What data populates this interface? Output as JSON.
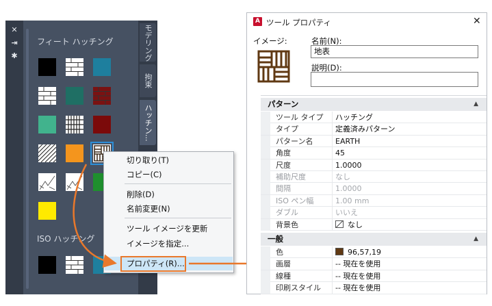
{
  "palette": {
    "strip_buttons": [
      "✕",
      "⇥",
      "✱"
    ],
    "section1_label": "フィート ハッチング",
    "section2_label": "ISO ハッチング",
    "tabs": [
      "モデリング",
      "拘束",
      "ハッチン..."
    ],
    "active_tab_index": 2,
    "swatches": [
      {
        "name": "swatch-solid-black",
        "color": "#000000",
        "pattern": "solid"
      },
      {
        "name": "swatch-brick",
        "color": "#ffffff",
        "pattern": "brick"
      },
      {
        "name": "swatch-solid-teal",
        "color": "#1e7f9e",
        "pattern": "solid"
      },
      {
        "name": "swatch-brick-white",
        "color": "#ffffff",
        "pattern": "brick"
      },
      {
        "name": "swatch-solid-darkteal",
        "color": "#1f6f64",
        "pattern": "solid"
      },
      {
        "name": "swatch-brick-red",
        "color": "#7a1212",
        "pattern": "brick"
      },
      {
        "name": "swatch-solid-seagreen",
        "color": "#41b38d",
        "pattern": "solid"
      },
      {
        "name": "swatch-grid",
        "color": "#ffffff",
        "pattern": "grid"
      },
      {
        "name": "swatch-solid-maroon",
        "color": "#7b0a0a",
        "pattern": "solid"
      },
      {
        "name": "swatch-diagonal",
        "color": "#ffffff",
        "pattern": "diagonal"
      },
      {
        "name": "swatch-solid-orange",
        "color": "#f4951d",
        "pattern": "solid"
      },
      {
        "name": "swatch-earth",
        "color": "#ffffff",
        "pattern": "earth"
      },
      {
        "name": "swatch-sketch1",
        "color": "#ffffff",
        "pattern": "sketch"
      },
      {
        "name": "swatch-sketch2",
        "color": "#ffffff",
        "pattern": "sketch"
      },
      {
        "name": "swatch-solid-green",
        "color": "#1f8f2e",
        "pattern": "solid"
      },
      {
        "name": "swatch-solid-yellow",
        "color": "#ffea00",
        "pattern": "solid"
      },
      {
        "name": "swatch-iso-black",
        "color": "#000000",
        "pattern": "solid"
      },
      {
        "name": "swatch-iso-brick",
        "color": "#ffffff",
        "pattern": "brick"
      },
      {
        "name": "swatch-iso-teal",
        "color": "#1e7f9e",
        "pattern": "solid"
      }
    ]
  },
  "context_menu": {
    "items": [
      "切り取り(T)",
      "コピー(C)",
      "削除(D)",
      "名前変更(N)",
      "ツール イメージを更新",
      "イメージを指定...",
      "プロパティ(R)..."
    ],
    "highlighted_index": 6
  },
  "dialog": {
    "title": "ツール プロパティ",
    "close": "✕",
    "app_icon": "A",
    "image_label": "イメージ:",
    "name_label": "名前(N):",
    "name_value": "地表",
    "desc_label": "説明(D):",
    "desc_value": "",
    "categories": [
      {
        "label": "パターン",
        "toggle": "▲",
        "rows": [
          {
            "name": "ツール タイプ",
            "value": "ハッチング",
            "dim": false
          },
          {
            "name": "タイプ",
            "value": "定義済みパターン",
            "dim": false
          },
          {
            "name": "パターン名",
            "value": "EARTH",
            "dim": false
          },
          {
            "name": "角度",
            "value": "45",
            "dim": false
          },
          {
            "name": "尺度",
            "value": "1.0000",
            "dim": false
          },
          {
            "name": "補助尺度",
            "value": "なし",
            "dim": true
          },
          {
            "name": "間隔",
            "value": "1.0000",
            "dim": true
          },
          {
            "name": "ISO ペン幅",
            "value": "1.00 mm",
            "dim": true
          },
          {
            "name": "ダブル",
            "value": "いいえ",
            "dim": true
          },
          {
            "name": "背景色",
            "value": "なし",
            "dim": false
          }
        ]
      },
      {
        "label": "一般",
        "toggle": "▲",
        "rows": [
          {
            "name": "色",
            "value": "96,57,19",
            "dim": false
          },
          {
            "name": "画層",
            "value": "-- 現在を使用",
            "dim": false
          },
          {
            "name": "線種",
            "value": "-- 現在を使用",
            "dim": false
          },
          {
            "name": "印刷スタイル",
            "value": "-- 現在を使用",
            "dim": false
          }
        ]
      }
    ],
    "colors": {
      "earth_brown": "#603913",
      "accent_orange": "#e9782b",
      "highlight_blue": "#2d8fd8"
    }
  }
}
